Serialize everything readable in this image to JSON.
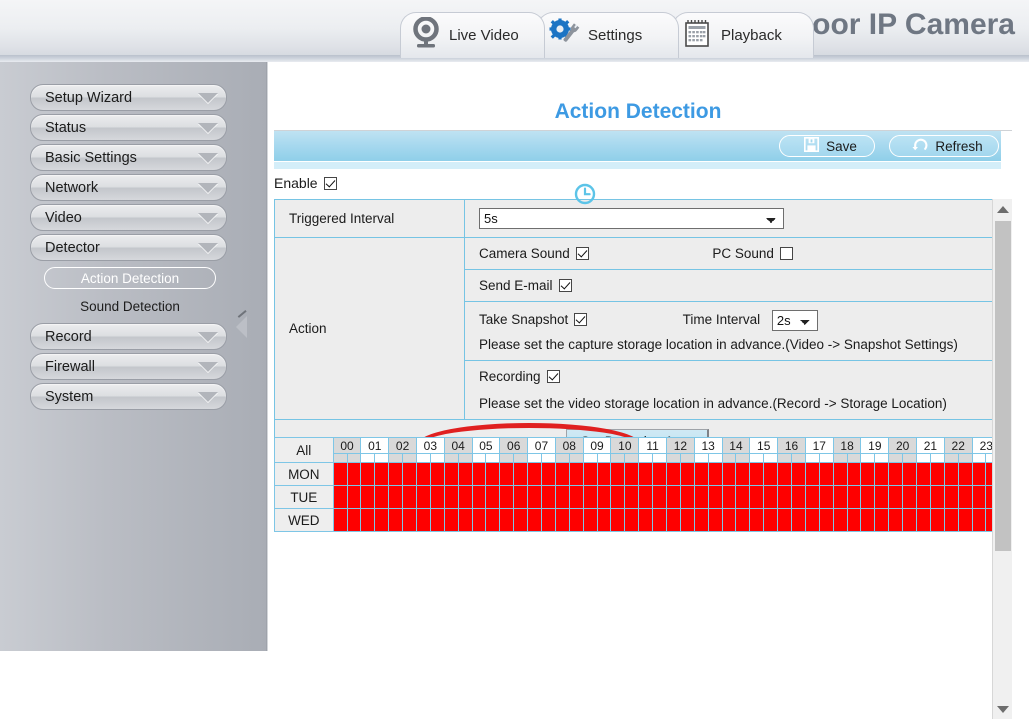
{
  "header": {
    "brand_title": "oor IP Camera",
    "tabs": [
      {
        "label": "Live Video",
        "icon": "webcam-icon"
      },
      {
        "label": "Settings",
        "icon": "gear-wrench-icon"
      },
      {
        "label": "Playback",
        "icon": "calendar-icon"
      }
    ]
  },
  "sidebar": {
    "items": [
      {
        "label": "Setup Wizard",
        "type": "group"
      },
      {
        "label": "Status",
        "type": "group"
      },
      {
        "label": "Basic Settings",
        "type": "group"
      },
      {
        "label": "Network",
        "type": "group"
      },
      {
        "label": "Video",
        "type": "group"
      },
      {
        "label": "Detector",
        "type": "group"
      },
      {
        "label": "Action Detection",
        "type": "sub",
        "selected": true
      },
      {
        "label": "Sound Detection",
        "type": "sub",
        "selected": false
      },
      {
        "label": "Record",
        "type": "group"
      },
      {
        "label": "Firewall",
        "type": "group"
      },
      {
        "label": "System",
        "type": "group"
      }
    ]
  },
  "main": {
    "page_title": "Action Detection",
    "toolbar": {
      "save_label": "Save",
      "refresh_label": "Refresh"
    },
    "enable": {
      "label": "Enable",
      "checked": true
    },
    "rows": {
      "triggered_interval_label": "Triggered Interval",
      "triggered_interval_value": "5s",
      "action_label": "Action",
      "camera_sound_label": "Camera Sound",
      "camera_sound_checked": true,
      "pc_sound_label": "PC Sound",
      "pc_sound_checked": false,
      "send_email_label": "Send E-mail",
      "send_email_checked": true,
      "take_snapshot_label": "Take Snapshot",
      "take_snapshot_checked": true,
      "time_interval_label": "Time Interval",
      "time_interval_value": "2s",
      "snapshot_note": "Please set the capture storage location in advance.(Video -> Snapshot Settings)",
      "recording_label": "Recording",
      "recording_checked": true,
      "recording_note": "Please set the video storage location in advance.(Record -> Storage Location)",
      "set_detection_area_label": "Set Detection Area"
    }
  },
  "schedule": {
    "all_label": "All",
    "hours": [
      "00",
      "01",
      "02",
      "03",
      "04",
      "05",
      "06",
      "07",
      "08",
      "09",
      "10",
      "11",
      "12",
      "13",
      "14",
      "15",
      "16",
      "17",
      "18",
      "19",
      "20",
      "21",
      "22",
      "23"
    ],
    "days": [
      "MON",
      "TUE",
      "WED"
    ],
    "selected_color": "#fe0000",
    "all_selected": true
  },
  "colors": {
    "accent_blue": "#3d9ae3",
    "toolbar_blue": "#a8d9ef",
    "grid_selected": "#fe0000",
    "annotation_red": "#e02020",
    "grid_border": "#76c4e4"
  }
}
